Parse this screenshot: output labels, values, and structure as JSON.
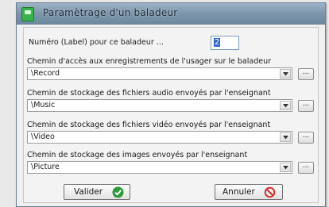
{
  "window": {
    "title": "Paramètrage d'un baladeur"
  },
  "label_field": {
    "label": "Numéro (Label) pour ce baladeur ...",
    "value": "2"
  },
  "paths": [
    {
      "label": "Chemin d'accès aux enregistrements de l'usager sur le baladeur",
      "value": "\\Record",
      "browse_label": "..."
    },
    {
      "label": "Chemin de stockage des fichiers audio envoyés par l'enseignant",
      "value": "\\Music",
      "browse_label": "..."
    },
    {
      "label": "Chemin de stockage des fichiers vidéo envoyés par l'enseignant",
      "value": "\\Video",
      "browse_label": "..."
    },
    {
      "label": "Chemin de stockage des images envoyés par l'enseignant",
      "value": "\\Picture",
      "browse_label": "..."
    }
  ],
  "buttons": {
    "validate": "Valider",
    "cancel": "Annuler"
  },
  "colors": {
    "validate_icon": "#2e9a3a",
    "cancel_icon": "#d0312d",
    "title_bar": "#7e97ad"
  }
}
